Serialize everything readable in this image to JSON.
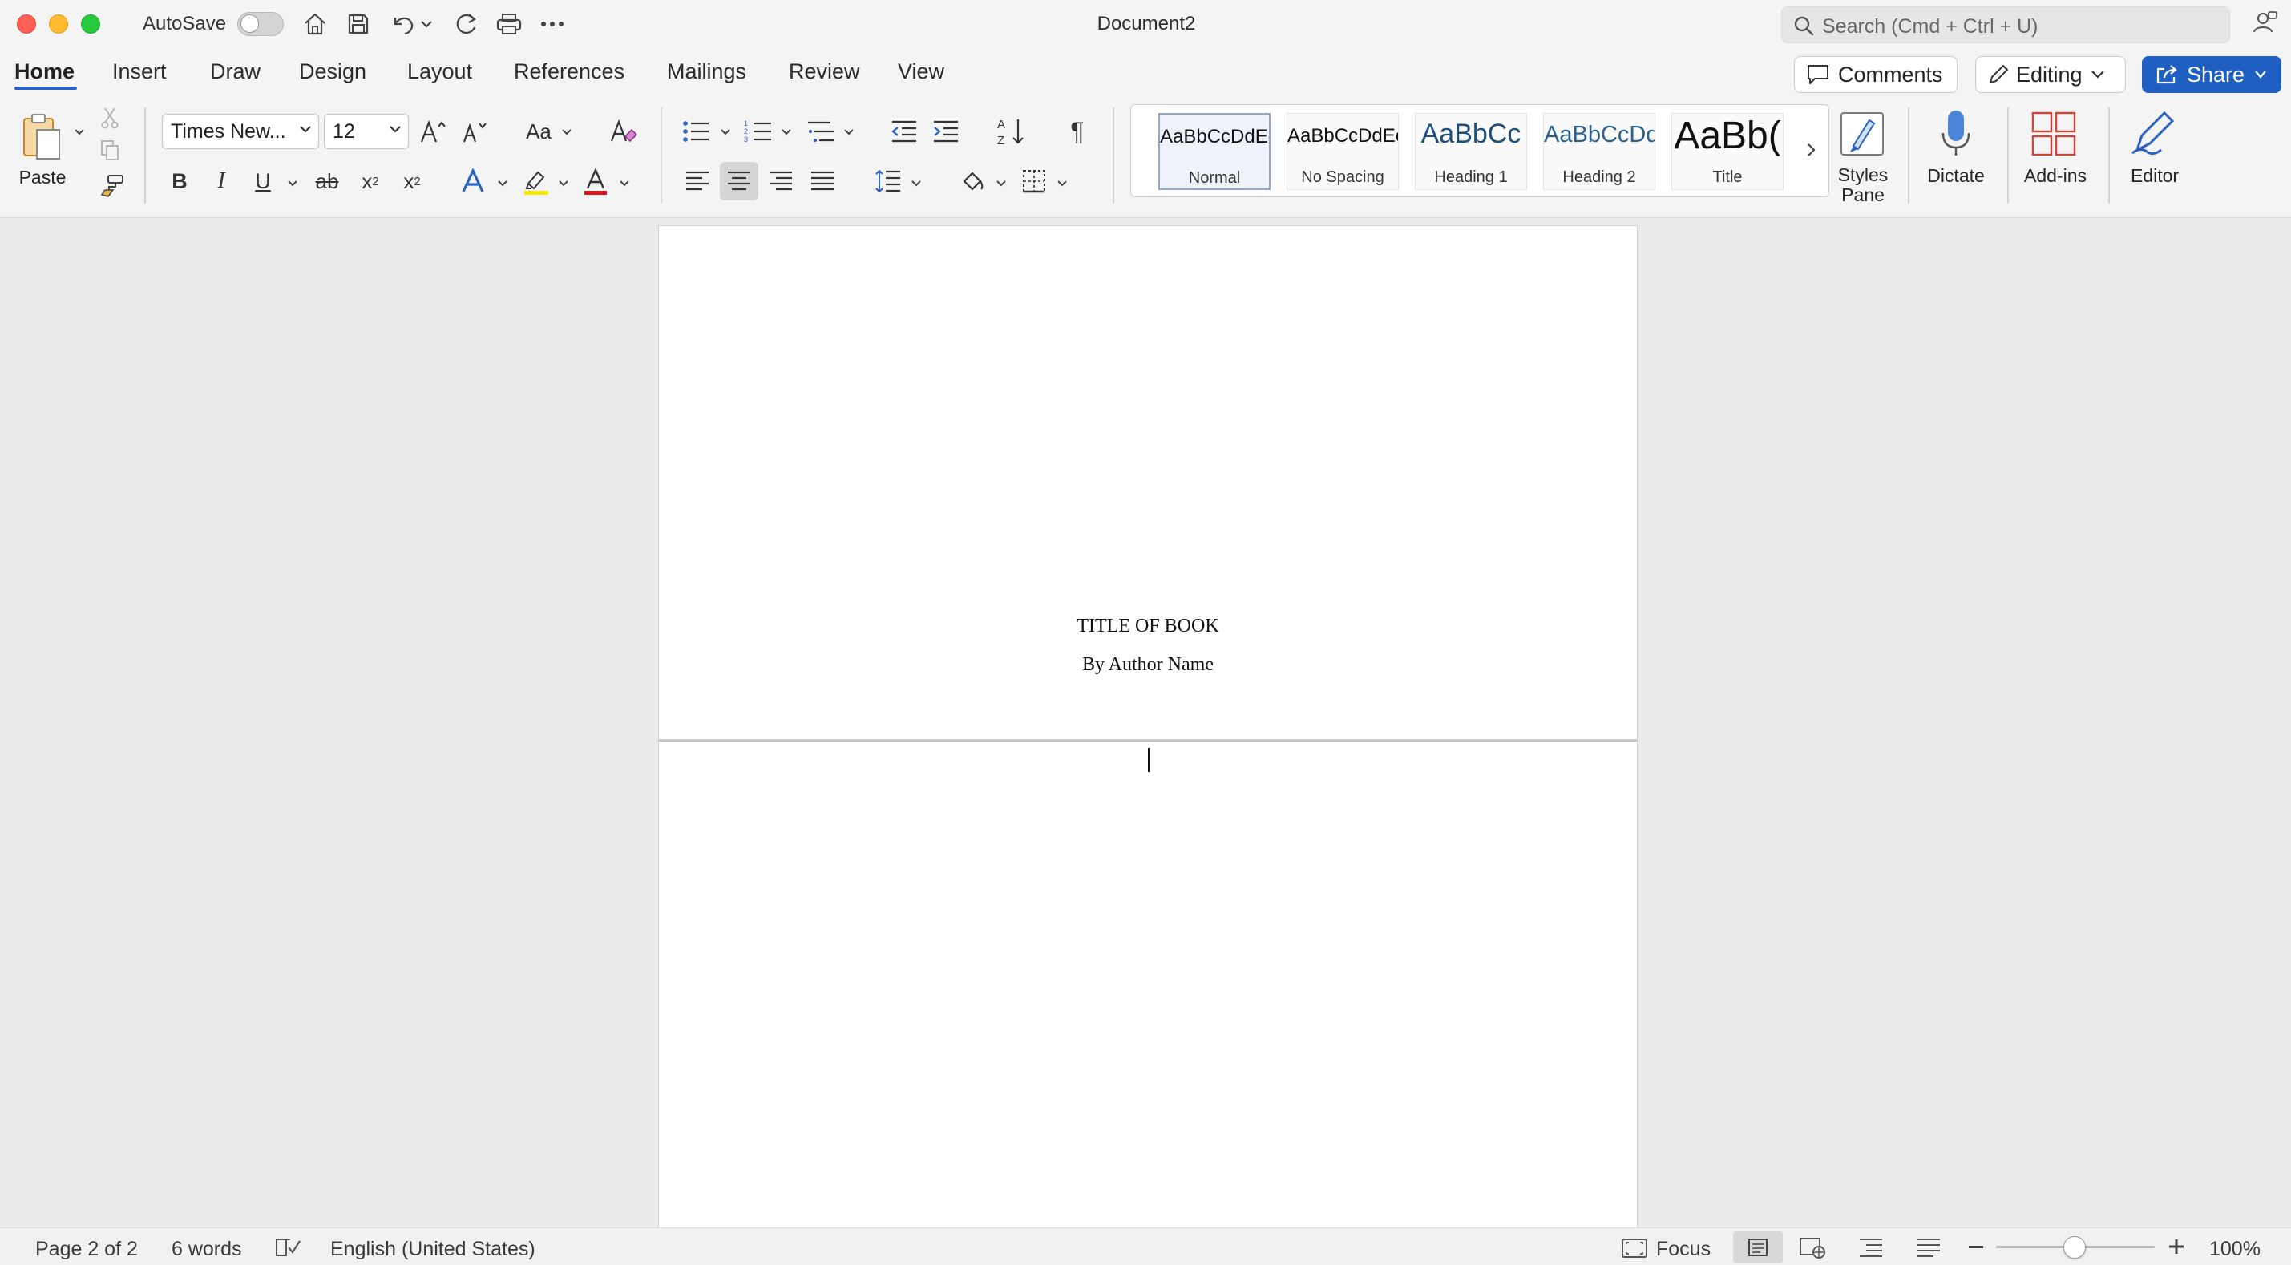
{
  "window": {
    "title": "Document2",
    "autosave_label": "AutoSave",
    "autosave_on": false,
    "search_placeholder": "Search (Cmd + Ctrl + U)"
  },
  "tabs": [
    {
      "label": "Home",
      "active": true
    },
    {
      "label": "Insert"
    },
    {
      "label": "Draw"
    },
    {
      "label": "Design"
    },
    {
      "label": "Layout"
    },
    {
      "label": "References"
    },
    {
      "label": "Mailings"
    },
    {
      "label": "Review"
    },
    {
      "label": "View"
    }
  ],
  "header_buttons": {
    "comments": "Comments",
    "editing": "Editing",
    "share": "Share"
  },
  "ribbon": {
    "paste_label": "Paste",
    "font_name": "Times New...",
    "font_size": "12",
    "change_case": "Aa",
    "styles": [
      {
        "sample": "AaBbCcDdEe",
        "name": "Normal",
        "selected": true
      },
      {
        "sample": "AaBbCcDdEe",
        "name": "No Spacing"
      },
      {
        "sample": "AaBbCc",
        "name": "Heading 1"
      },
      {
        "sample": "AaBbCcDd",
        "name": "Heading 2"
      },
      {
        "sample": "AaBb(",
        "name": "Title"
      }
    ],
    "styles_pane_line1": "Styles",
    "styles_pane_line2": "Pane",
    "dictate": "Dictate",
    "addins": "Add-ins",
    "editor": "Editor",
    "colors": {
      "highlight": "#f5e900",
      "font_color": "#e0141e",
      "text_effects": "#2b62c1",
      "accent": "#2b62c1",
      "share_bg": "#1e5fc1"
    }
  },
  "document": {
    "title_line": "TITLE OF BOOK",
    "author_line": "By Author Name"
  },
  "status": {
    "page": "Page 2 of 2",
    "words": "6 words",
    "language": "English (United States)",
    "focus": "Focus",
    "zoom": "100%",
    "zoom_level": 1.0
  }
}
